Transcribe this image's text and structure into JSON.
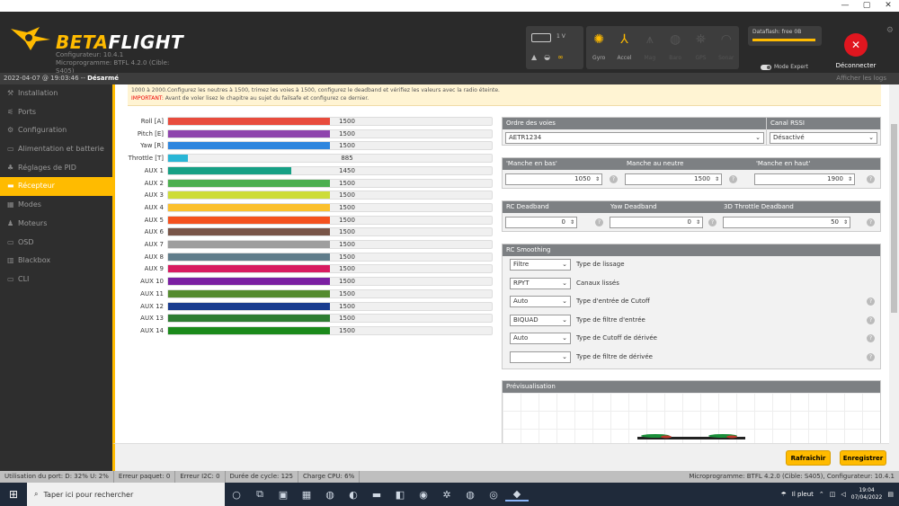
{
  "window": {
    "minimize": "—",
    "maximize": "▢",
    "close": "✕"
  },
  "header": {
    "brand_left": "BETA",
    "brand_right": "FLIGHT",
    "configurator": "Configurateur: 10.4.1",
    "firmware": "Microprogramme: BTFL 4.2.0 (Cible: S405)",
    "battery_voltage": "1 V",
    "sensors": [
      {
        "label": "Gyro",
        "icon": "gyro-icon",
        "on": true
      },
      {
        "label": "Accel",
        "icon": "accel-icon",
        "on": true
      },
      {
        "label": "Mag",
        "icon": "mag-icon",
        "on": false
      },
      {
        "label": "Baro",
        "icon": "baro-icon",
        "on": false
      },
      {
        "label": "GPS",
        "icon": "gps-icon",
        "on": false
      },
      {
        "label": "Sonar",
        "icon": "sonar-icon",
        "on": false
      }
    ],
    "dataflash": "Dataflash: free 0B",
    "expert_mode": "Mode Expert",
    "disconnect": "Déconnecter"
  },
  "status": {
    "datetime": "2022-04-07 @ 19:03:46 -- ",
    "armed": "Désarmé",
    "show_logs": "Afficher les logs"
  },
  "sidebar": {
    "items": [
      {
        "label": "Installation",
        "icon": "wrench-icon"
      },
      {
        "label": "Ports",
        "icon": "plug-icon"
      },
      {
        "label": "Configuration",
        "icon": "gear-icon"
      },
      {
        "label": "Alimentation et batterie",
        "icon": "battery-icon"
      },
      {
        "label": "Réglages de PID",
        "icon": "pid-icon"
      },
      {
        "label": "Récepteur",
        "icon": "receiver-icon",
        "active": true
      },
      {
        "label": "Modes",
        "icon": "modes-icon"
      },
      {
        "label": "Moteurs",
        "icon": "motor-icon"
      },
      {
        "label": "OSD",
        "icon": "osd-icon"
      },
      {
        "label": "Blackbox",
        "icon": "blackbox-icon"
      },
      {
        "label": "CLI",
        "icon": "cli-icon"
      }
    ]
  },
  "notice": {
    "line1": "1000 à 2000.Configurez les neutres à 1500, trimez les voies à 1500, configurez le deadband et vérifiez les valeurs avec la radio éteinte.",
    "important_label": "IMPORTANT:",
    "line2": " Avant de voler lisez le chapitre au sujet du failsafe et configurez ce dernier."
  },
  "channels": [
    {
      "name": "Roll [A]",
      "value": "1500",
      "fill": 0.5,
      "color": "#e84c3d"
    },
    {
      "name": "Pitch [E]",
      "value": "1500",
      "fill": 0.5,
      "color": "#8e44ad"
    },
    {
      "name": "Yaw [R]",
      "value": "1500",
      "fill": 0.5,
      "color": "#2e86de"
    },
    {
      "name": "Throttle [T]",
      "value": "885",
      "fill": 0.06,
      "color": "#29b6d6"
    },
    {
      "name": "AUX 1",
      "value": "1450",
      "fill": 0.38,
      "color": "#16a085"
    },
    {
      "name": "AUX 2",
      "value": "1500",
      "fill": 0.5,
      "color": "#4caf50"
    },
    {
      "name": "AUX 3",
      "value": "1500",
      "fill": 0.5,
      "color": "#cddc39"
    },
    {
      "name": "AUX 4",
      "value": "1500",
      "fill": 0.5,
      "color": "#fbc02d"
    },
    {
      "name": "AUX 5",
      "value": "1500",
      "fill": 0.5,
      "color": "#f4511e"
    },
    {
      "name": "AUX 6",
      "value": "1500",
      "fill": 0.5,
      "color": "#795548"
    },
    {
      "name": "AUX 7",
      "value": "1500",
      "fill": 0.5,
      "color": "#9e9e9e"
    },
    {
      "name": "AUX 8",
      "value": "1500",
      "fill": 0.5,
      "color": "#607d8b"
    },
    {
      "name": "AUX 9",
      "value": "1500",
      "fill": 0.5,
      "color": "#d81b60"
    },
    {
      "name": "AUX 10",
      "value": "1500",
      "fill": 0.5,
      "color": "#7b1fa2"
    },
    {
      "name": "AUX 11",
      "value": "1500",
      "fill": 0.5,
      "color": "#558b2f"
    },
    {
      "name": "AUX 12",
      "value": "1500",
      "fill": 0.5,
      "color": "#1a3c8f"
    },
    {
      "name": "AUX 13",
      "value": "1500",
      "fill": 0.5,
      "color": "#2e7d32"
    },
    {
      "name": "AUX 14",
      "value": "1500",
      "fill": 0.5,
      "color": "#1b8a1b"
    }
  ],
  "channel_map": {
    "header": "Ordre des voies",
    "value": "AETR1234"
  },
  "rssi": {
    "header": "Canal RSSI",
    "value": "Désactivé"
  },
  "sticks": {
    "low_header": "'Manche en bas'",
    "low": "1050",
    "center_header": "Manche au neutre",
    "center": "1500",
    "high_header": "'Manche en haut'",
    "high": "1900"
  },
  "deadband": {
    "rc_header": "RC Deadband",
    "rc": "0",
    "yaw_header": "Yaw Deadband",
    "yaw": "0",
    "throttle_header": "3D Throttle Deadband",
    "throttle": "50"
  },
  "smoothing": {
    "header": "RC Smoothing",
    "rows": [
      {
        "value": "Filtre",
        "label": "Type de lissage",
        "help": false
      },
      {
        "value": "RPYT",
        "label": "Canaux lissés",
        "help": false
      },
      {
        "value": "Auto",
        "label": "Type d'entrée de Cutoff",
        "help": true
      },
      {
        "value": "BIQUAD",
        "label": "Type de filtre d'entrée",
        "help": true
      },
      {
        "value": "Auto",
        "label": "Type de Cutoff de dérivée",
        "help": true
      },
      {
        "value": "",
        "label": "Type de filtre de dérivée",
        "help": true
      }
    ]
  },
  "preview": {
    "header": "Prévisualisation"
  },
  "buttons": {
    "refresh": "Rafraîchir",
    "save": "Enregistrer"
  },
  "footer": {
    "port": "Utilisation du port: D: 32% U: 2%",
    "packet_error": "Erreur paquet: 0",
    "i2c_error": "Erreur I2C: 0",
    "cycle": "Durée de cycle: 125",
    "cpu": "Charge CPU: 6%",
    "firmware": "Microprogramme: BTFL 4.2.0 (Cible: S405), Configurateur: 10.4.1"
  },
  "taskbar": {
    "search_placeholder": "Taper ici pour rechercher",
    "weather": "Il pleut",
    "time": "19:04",
    "date": "07/04/2022"
  }
}
